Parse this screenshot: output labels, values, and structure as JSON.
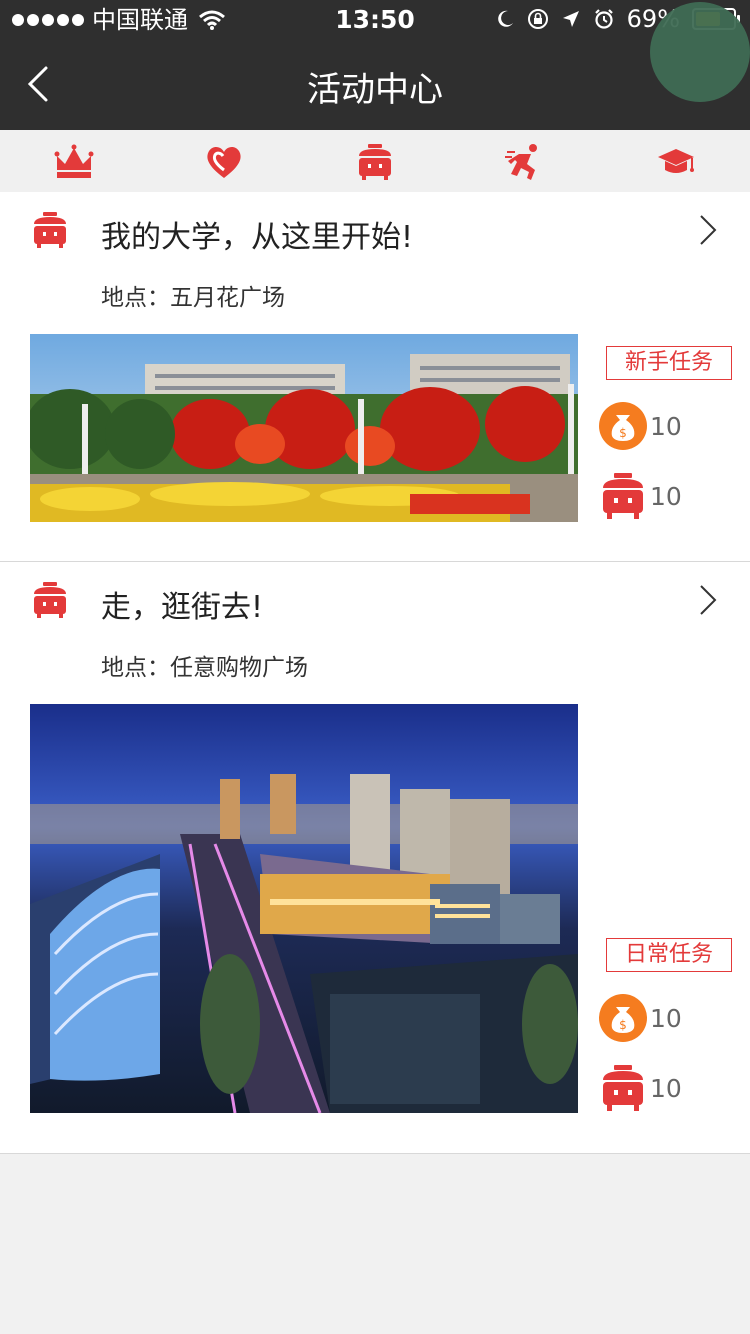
{
  "status_bar": {
    "carrier": "中国联通",
    "time": "13:50",
    "battery": "69%",
    "battery_level": 0.69
  },
  "nav": {
    "title": "活动中心"
  },
  "categories": [
    {
      "icon": "crown-icon"
    },
    {
      "icon": "heart-icon"
    },
    {
      "icon": "rice-cooker-icon"
    },
    {
      "icon": "runner-icon"
    },
    {
      "icon": "graduation-cap-icon"
    }
  ],
  "activities": [
    {
      "title": "我的大学，从这里开始!",
      "location": "地点：五月花广场",
      "image": "campus-photo",
      "task_type": "新手任务",
      "coin_reward": "10",
      "cooker_reward": "10"
    },
    {
      "title": "走，逛街去!",
      "location": "地点：任意购物广场",
      "image": "shopping-mall-photo",
      "task_type": "日常任务",
      "coin_reward": "10",
      "cooker_reward": "10"
    }
  ],
  "colors": {
    "accent": "#e33a3a",
    "header": "#2f2f2f",
    "coin": "#f57c1f"
  }
}
